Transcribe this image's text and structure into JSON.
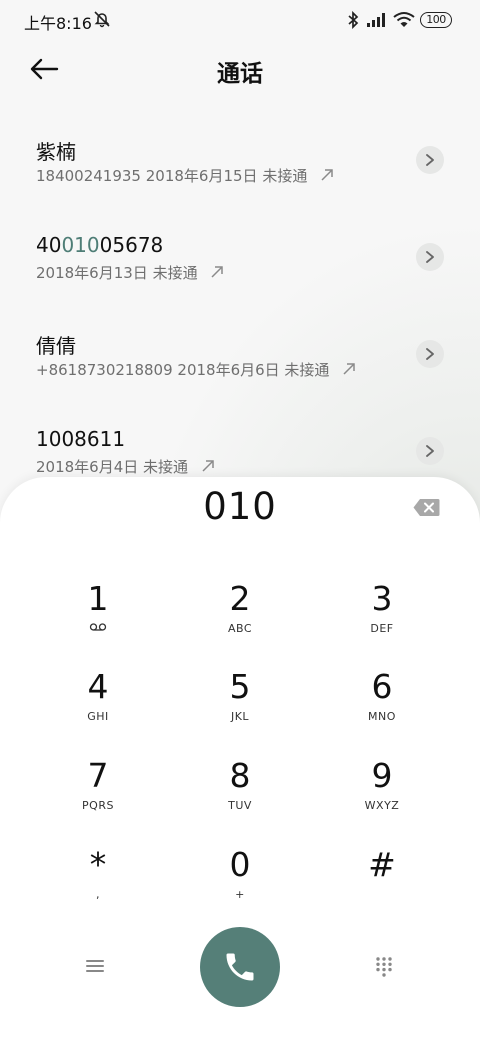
{
  "status_bar": {
    "time": "上午8:16",
    "battery": "100",
    "icons": [
      "dnd-icon",
      "bluetooth-icon",
      "signal-icon",
      "wifi-icon",
      "battery-icon"
    ]
  },
  "header": {
    "title": "通话",
    "back_icon": "back-arrow-icon"
  },
  "calls": [
    {
      "name": "紫楠",
      "detail": "18400241935  2018年6月15日  未接通"
    },
    {
      "name_prefix": "40",
      "name_highlight": "010",
      "name_suffix": "05678",
      "detail": "2018年6月13日  未接通"
    },
    {
      "name": "倩倩",
      "detail": "+8618730218809  2018年6月6日  未接通"
    },
    {
      "name": "1008611",
      "detail": "2018年6月4日  未接通"
    }
  ],
  "dialpad": {
    "number": "010",
    "keys": [
      {
        "digit": "1",
        "sub": ""
      },
      {
        "digit": "2",
        "sub": "ABC"
      },
      {
        "digit": "3",
        "sub": "DEF"
      },
      {
        "digit": "4",
        "sub": "GHI"
      },
      {
        "digit": "5",
        "sub": "JKL"
      },
      {
        "digit": "6",
        "sub": "MNO"
      },
      {
        "digit": "7",
        "sub": "PQRS"
      },
      {
        "digit": "8",
        "sub": "TUV"
      },
      {
        "digit": "9",
        "sub": "WXYZ"
      },
      {
        "digit": "*",
        "sub": ","
      },
      {
        "digit": "0",
        "sub": "+"
      },
      {
        "digit": "#",
        "sub": ""
      }
    ]
  },
  "colors": {
    "accent": "#557f78",
    "highlight": "#4e7d76"
  }
}
